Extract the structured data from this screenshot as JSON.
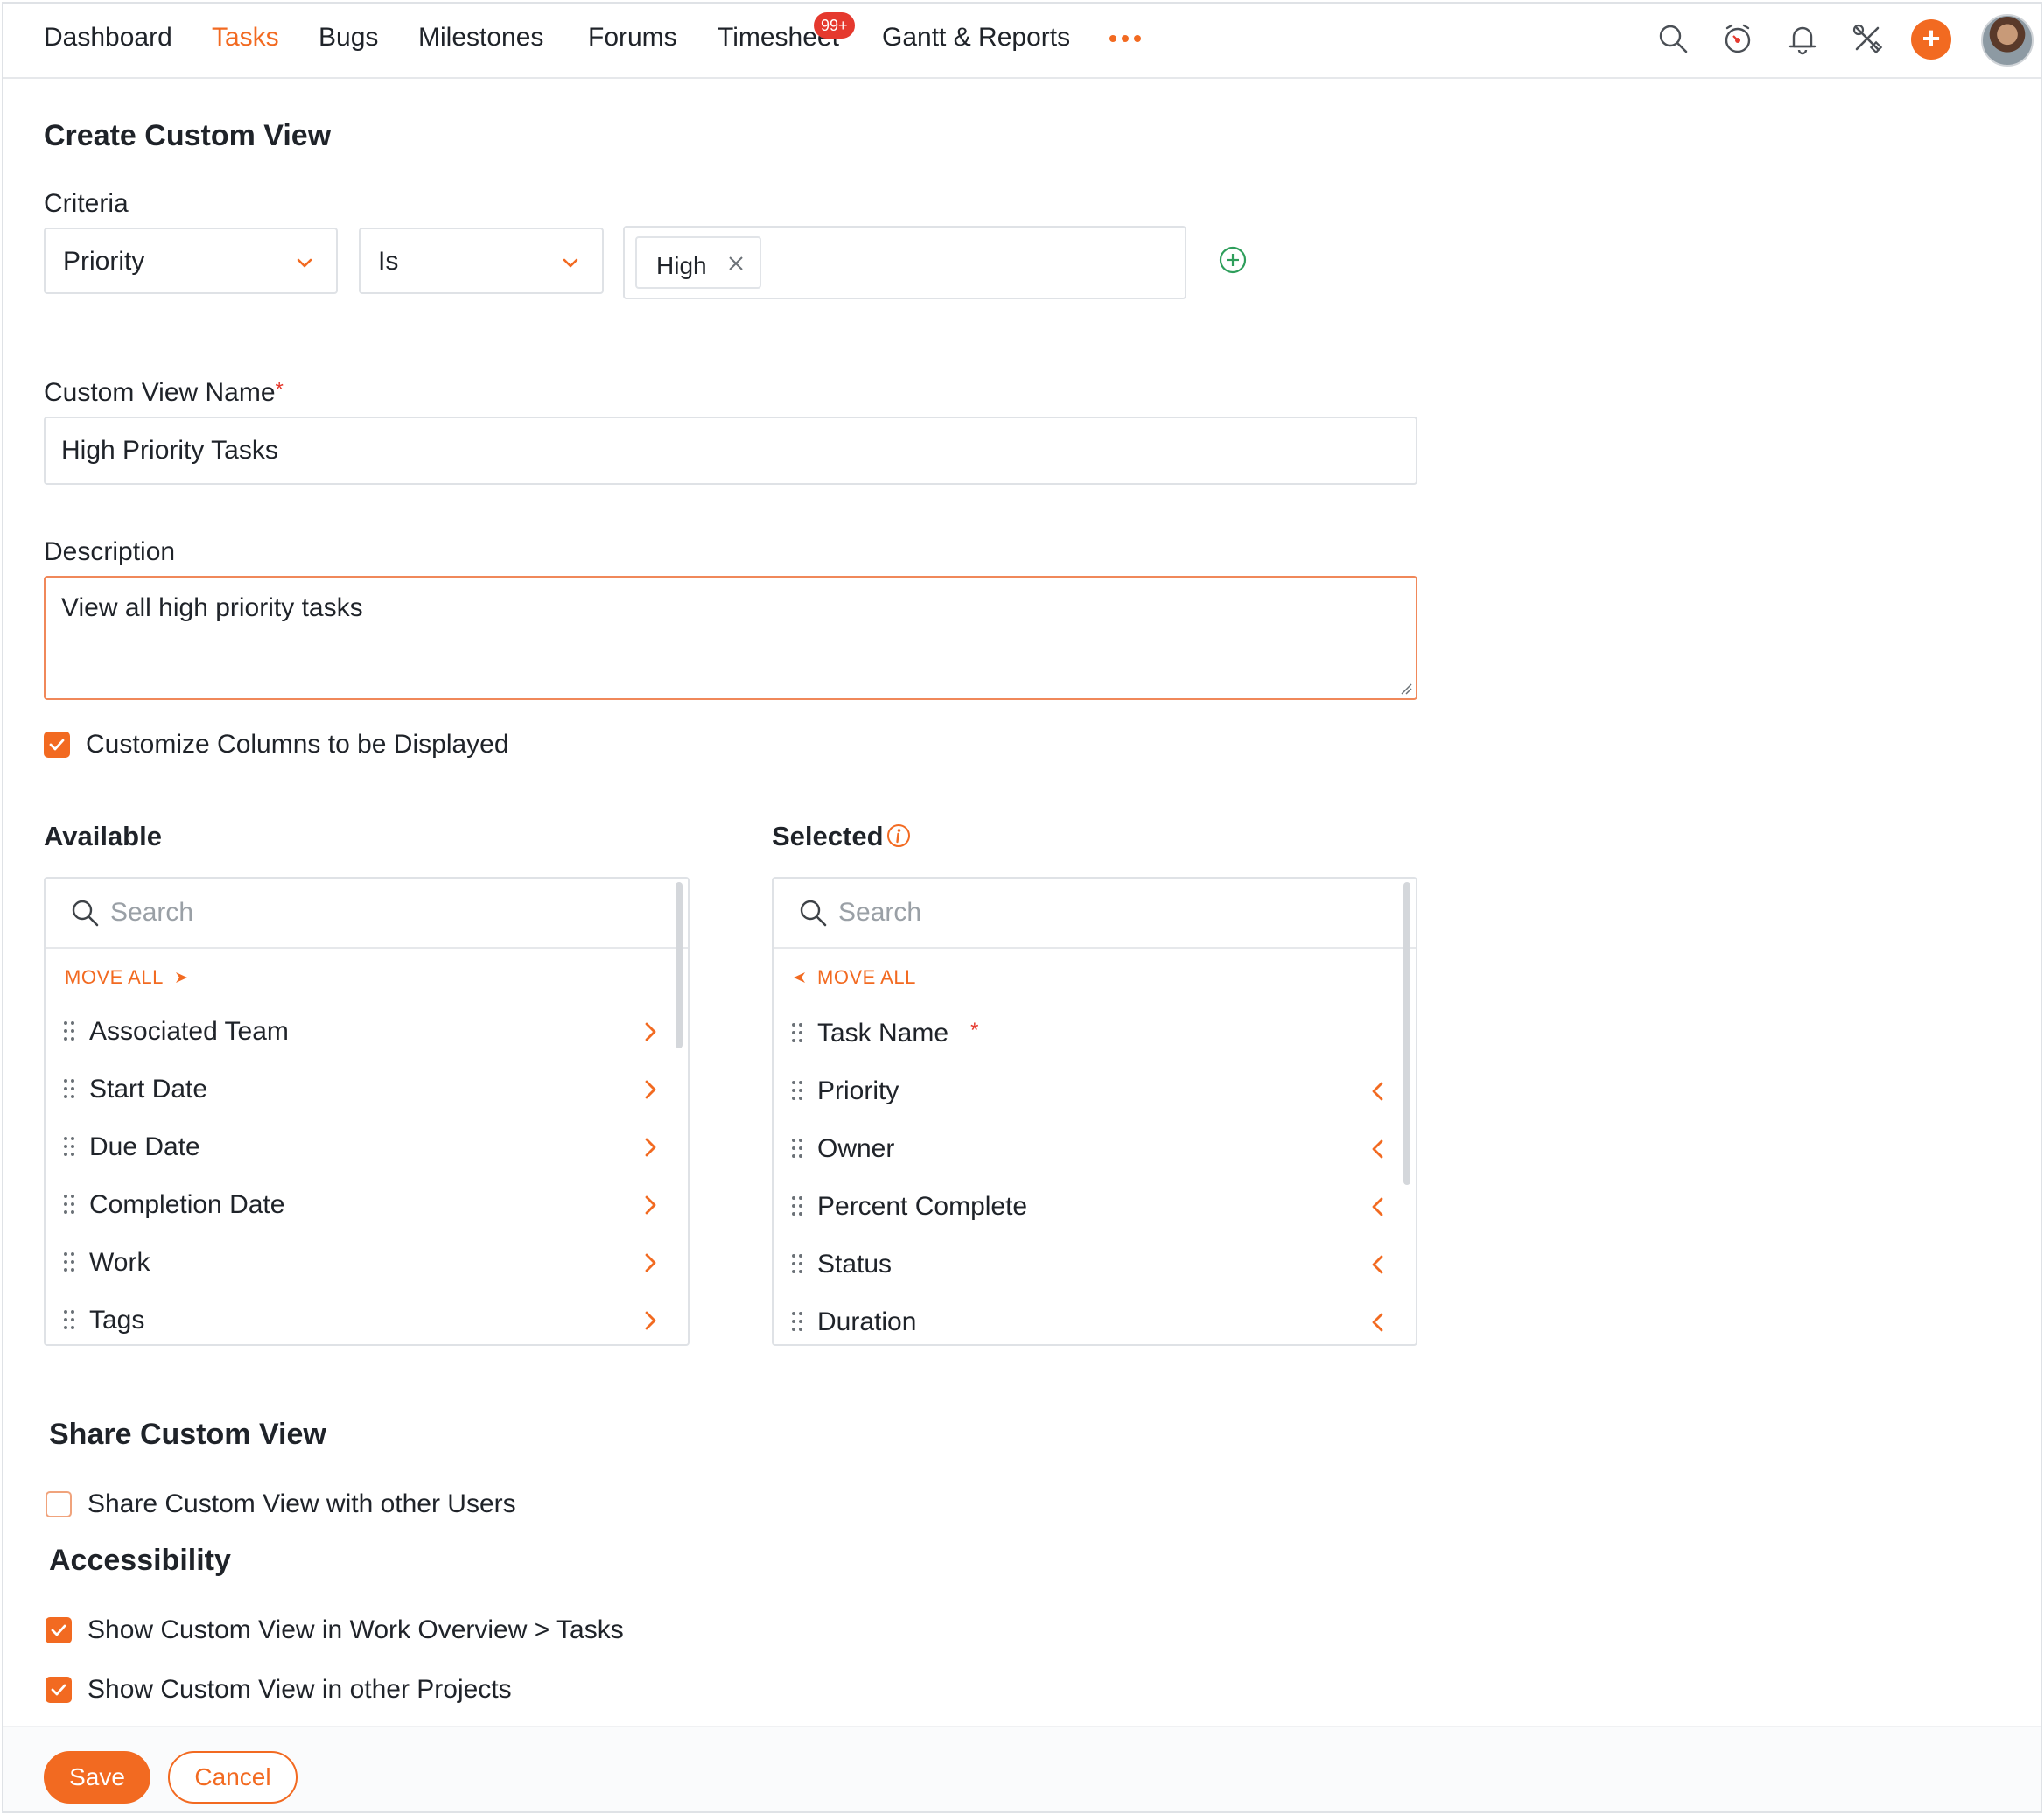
{
  "nav": {
    "items": [
      {
        "label": "Dashboard",
        "active": false
      },
      {
        "label": "Tasks",
        "active": true
      },
      {
        "label": "Bugs",
        "active": false
      },
      {
        "label": "Milestones",
        "active": false
      },
      {
        "label": "Forums",
        "active": false
      },
      {
        "label": "Timesheet",
        "active": false
      },
      {
        "label": "Gantt & Reports",
        "active": false
      }
    ],
    "timesheet_badge": "99+",
    "icons": [
      "search-icon",
      "timer-icon",
      "bell-icon",
      "tools-icon",
      "plus-icon",
      "avatar"
    ],
    "plus_glyph": "+"
  },
  "page": {
    "title": "Create Custom View"
  },
  "criteria": {
    "label": "Criteria",
    "field": "Priority",
    "operator": "Is",
    "values": [
      {
        "label": "High"
      }
    ]
  },
  "name_field": {
    "label": "Custom View Name",
    "required_mark": "*",
    "value": "High Priority Tasks"
  },
  "description": {
    "label": "Description",
    "value": "View all high priority tasks"
  },
  "customize_columns": {
    "label": "Customize Columns to be Displayed",
    "checked": true
  },
  "available": {
    "title": "Available",
    "search_placeholder": "Search",
    "move_all": "MOVE ALL",
    "items": [
      "Associated Team",
      "Start Date",
      "Due Date",
      "Completion Date",
      "Work",
      "Tags"
    ]
  },
  "selected": {
    "title": "Selected",
    "search_placeholder": "Search",
    "move_all": "MOVE ALL",
    "items": [
      {
        "label": "Task Name",
        "required": true
      },
      {
        "label": "Priority",
        "required": false
      },
      {
        "label": "Owner",
        "required": false
      },
      {
        "label": "Percent Complete",
        "required": false
      },
      {
        "label": "Status",
        "required": false
      },
      {
        "label": "Duration",
        "required": false
      }
    ],
    "required_mark": "*"
  },
  "share": {
    "title": "Share Custom View",
    "option_label": "Share Custom View with other Users",
    "checked": false
  },
  "accessibility": {
    "title": "Accessibility",
    "options": [
      {
        "label": "Show Custom View in Work Overview > Tasks",
        "checked": true
      },
      {
        "label": "Show Custom View in other Projects",
        "checked": true
      }
    ]
  },
  "footer": {
    "save_label": "Save",
    "cancel_label": "Cancel"
  },
  "colors": {
    "accent": "#f26a21",
    "badge": "#e5392e",
    "add_criteria": "#2e9e5b"
  }
}
